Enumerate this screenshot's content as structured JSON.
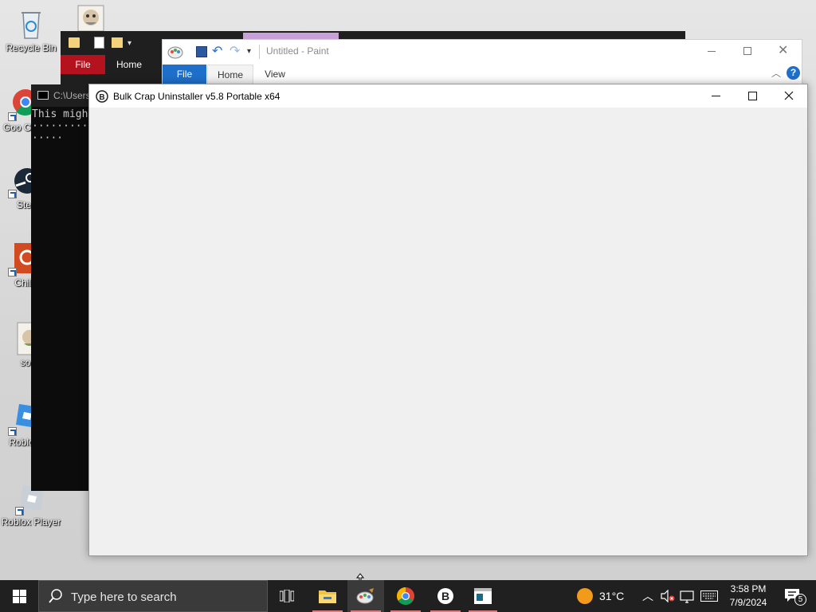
{
  "desktop": {
    "icons": [
      {
        "label": "Recycle Bin"
      },
      {
        "label": "Goo Chro"
      },
      {
        "label": "Ste"
      },
      {
        "label": "Chill"
      },
      {
        "label": "so"
      },
      {
        "label": "Roblox"
      },
      {
        "label": "Roblox Player"
      }
    ]
  },
  "explorer": {
    "tabs": {
      "file": "File",
      "home": "Home"
    }
  },
  "console": {
    "title": "C:\\Users",
    "lines": [
      "This migh",
      "··········",
      "·····"
    ]
  },
  "paint": {
    "title": "Untitled - Paint",
    "tabs": {
      "file": "File",
      "home": "Home",
      "view": "View"
    }
  },
  "bcu": {
    "title": "Bulk Crap Uninstaller v5.8 Portable x64"
  },
  "taskbar": {
    "search_placeholder": "Type here to search",
    "weather_temp": "31°C",
    "time": "3:58 PM",
    "date": "7/9/2024",
    "notification_count": "5"
  },
  "colors": {
    "paint_file_tab": "#1e6fc9",
    "explorer_file_tab": "#b4121e",
    "taskbar_bg": "#202020",
    "bcu_client": "#f0f0f0"
  }
}
